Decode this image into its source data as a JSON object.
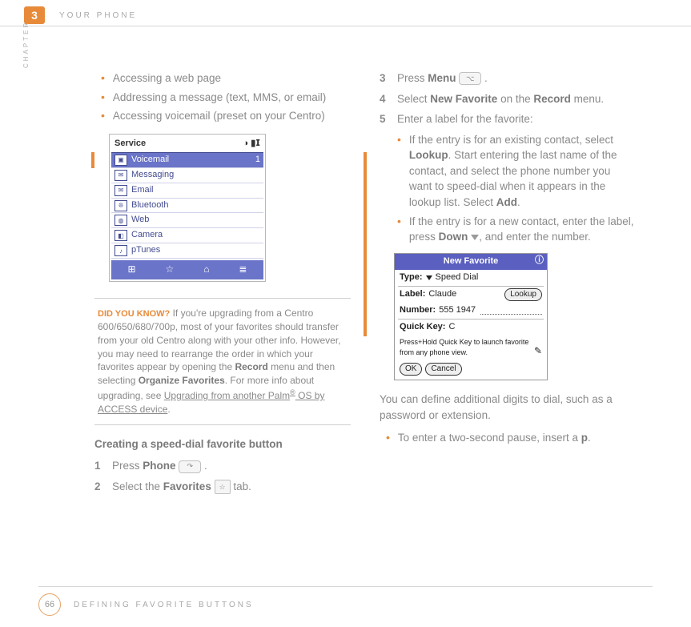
{
  "header": {
    "chapter_number": "3",
    "title": "YOUR PHONE",
    "side_label": "CHAPTER"
  },
  "left_col": {
    "bullets": [
      "Accessing a web page",
      "Addressing a message (text, MMS, or email)",
      "Accessing voicemail (preset on your Centro)"
    ],
    "service_shot": {
      "title": "Service",
      "signal": "◑ ▮𝗜",
      "rows": [
        {
          "icon": "▣",
          "label": "Voicemail",
          "right": "1",
          "selected": true
        },
        {
          "icon": "✉",
          "label": "Messaging",
          "right": "",
          "selected": false
        },
        {
          "icon": "✉",
          "label": "Email",
          "right": "",
          "selected": false
        },
        {
          "icon": "❊",
          "label": "Bluetooth",
          "right": "",
          "selected": false
        },
        {
          "icon": "◍",
          "label": "Web",
          "right": "",
          "selected": false
        },
        {
          "icon": "◧",
          "label": "Camera",
          "right": "",
          "selected": false
        },
        {
          "icon": "♪",
          "label": "pTunes",
          "right": "",
          "selected": false
        }
      ],
      "bar": [
        "⊞",
        "☆",
        "⌂",
        "≣"
      ]
    },
    "tip": {
      "label": "DID YOU KNOW?",
      "text_before": "If you're upgrading from a Centro 600/650/680/700p, most of your favorites should transfer from your old Centro along with your other info. However, you may need to rearrange the order in which your favorites appear by opening the ",
      "bold1": "Record",
      "text_mid": " menu and then selecting ",
      "bold2": "Organize Favorites",
      "text_after1": ". For more info about upgrading, see ",
      "link1": "Upgrading from another Palm",
      "reg": "®",
      "link2": " OS by ACCESS device",
      "dot": "."
    },
    "section_title": "Creating a speed-dial favorite button",
    "steps": {
      "s1_pre": "Press ",
      "s1_bold": "Phone",
      "s1_post": " ",
      "s1_icon": "↷",
      "s1_end": " .",
      "s2_pre": "Select the ",
      "s2_bold": "Favorites",
      "s2_post": " ",
      "s2_icon": "☆",
      "s2_end": " tab."
    }
  },
  "right_col": {
    "steps": {
      "s3_pre": "Press ",
      "s3_bold": "Menu",
      "s3_icon": "⌥",
      "s3_end": " .",
      "s4_pre": "Select ",
      "s4_bold1": "New Favorite",
      "s4_mid": " on the ",
      "s4_bold2": "Record",
      "s4_end": " menu.",
      "s5": "Enter a label for the favorite:"
    },
    "sub": {
      "b1_pre": "If the entry is for an existing contact, select ",
      "b1_bold1": "Lookup",
      "b1_mid": ". Start entering the last name of the contact, and select the phone number you want to speed-dial when it appears in the lookup list. Select ",
      "b1_bold2": "Add",
      "b1_end": ".",
      "b2_pre": "If the entry is for a new contact, enter the label, press ",
      "b2_bold": "Down",
      "b2_end": ", and enter the number."
    },
    "nf_shot": {
      "title": "New Favorite",
      "info": "ⓘ",
      "type_label": "Type:",
      "type_value": "Speed Dial",
      "label_label": "Label:",
      "label_value": "Claude",
      "lookup_btn": "Lookup",
      "number_label": "Number:",
      "number_value": "555 1947",
      "qk_label": "Quick Key:",
      "qk_value": "C",
      "hint": "Press+Hold Quick Key to launch favorite from any phone view.",
      "ok": "OK",
      "cancel": "Cancel"
    },
    "after1": "You can define additional digits to dial, such as a password or extension.",
    "after2_pre": "To enter a two-second pause, insert a ",
    "after2_bold": "p",
    "after2_end": "."
  },
  "footer": {
    "page": "66",
    "title": "DEFINING FAVORITE BUTTONS"
  }
}
